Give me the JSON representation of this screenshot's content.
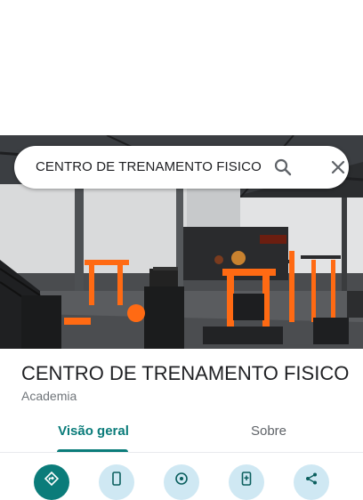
{
  "search": {
    "query": "CENTRO DE TRENAMENTO FISICO",
    "search_icon": "search-icon",
    "close_icon": "close-icon"
  },
  "place": {
    "name": "CENTRO DE TRENAMENTO FISICO",
    "category": "Academia",
    "photo_description_icon": "gym-photo"
  },
  "tabs": [
    {
      "label": "Visão geral",
      "selected": true
    },
    {
      "label": "Sobre",
      "selected": false
    }
  ],
  "actions": [
    {
      "icon": "directions-icon",
      "primary": true
    },
    {
      "icon": "phone-icon"
    },
    {
      "icon": "nearby-icon"
    },
    {
      "icon": "save-to-phone-icon"
    },
    {
      "icon": "share-icon"
    }
  ],
  "colors": {
    "accent": "#0b7c7a",
    "action_bg": "#cfe8f3",
    "gym_orange": "#ff6a13"
  }
}
